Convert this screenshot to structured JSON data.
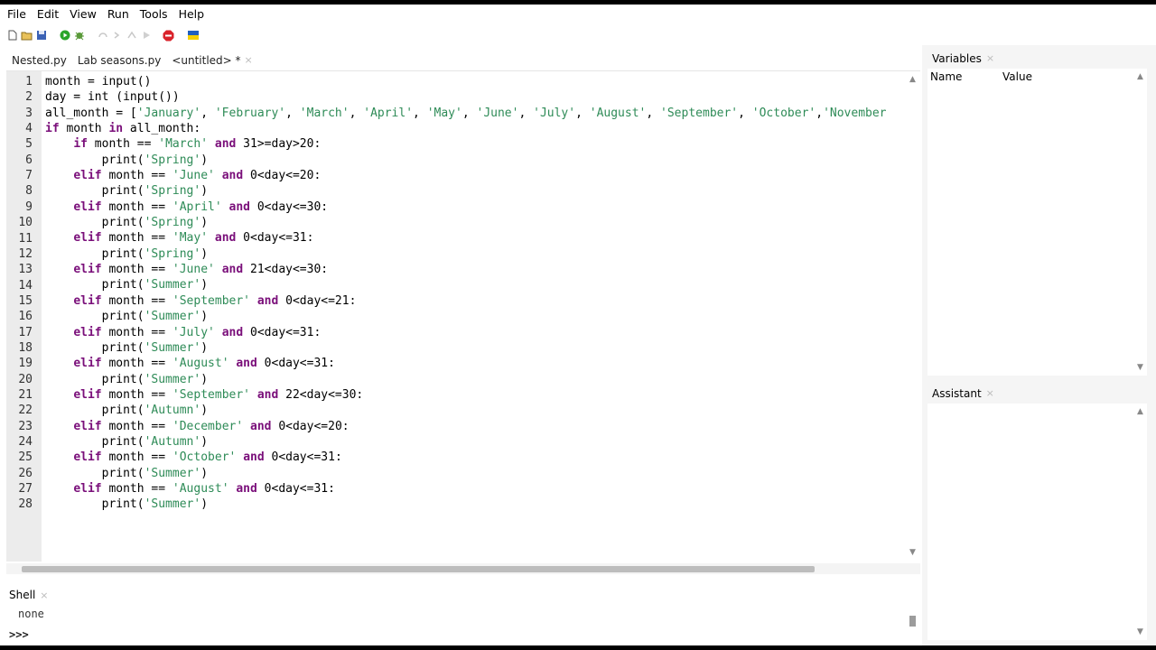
{
  "menu": [
    "File",
    "Edit",
    "View",
    "Run",
    "Tools",
    "Help"
  ],
  "toolbar_icons": [
    "new-file-icon",
    "open-file-icon",
    "save-icon",
    "run-icon",
    "debug-icon",
    "step-over-icon",
    "step-into-icon",
    "step-out-icon",
    "resume-icon",
    "stop-icon",
    "ukraine-flag-icon"
  ],
  "colors": {
    "keyword": "#7a0f7a",
    "string": "#2e8b57",
    "gutter": "#ececec",
    "panel": "#f5f5f5",
    "run": "#2aa52a",
    "stop": "#d9232b"
  },
  "editor_tabs": [
    {
      "label": "Nested.py",
      "active": false
    },
    {
      "label": "Lab seasons.py",
      "active": false
    },
    {
      "label": "<untitled> *",
      "active": true
    }
  ],
  "tab_close": "×",
  "code_lines": [
    [
      [
        "",
        "month = input()"
      ]
    ],
    [
      [
        "",
        "day = int (input())"
      ]
    ],
    [
      [
        "",
        "all_month = ["
      ],
      [
        "s",
        "'January'"
      ],
      [
        "",
        ", "
      ],
      [
        "s",
        "'February'"
      ],
      [
        "",
        ", "
      ],
      [
        "s",
        "'March'"
      ],
      [
        "",
        ", "
      ],
      [
        "s",
        "'April'"
      ],
      [
        "",
        ", "
      ],
      [
        "s",
        "'May'"
      ],
      [
        "",
        ", "
      ],
      [
        "s",
        "'June'"
      ],
      [
        "",
        ", "
      ],
      [
        "s",
        "'July'"
      ],
      [
        "",
        ", "
      ],
      [
        "s",
        "'August'"
      ],
      [
        "",
        ", "
      ],
      [
        "s",
        "'September'"
      ],
      [
        "",
        ", "
      ],
      [
        "s",
        "'October'"
      ],
      [
        "",
        ","
      ],
      [
        "s",
        "'November"
      ]
    ],
    [
      [
        "k",
        "if"
      ],
      [
        "",
        " month "
      ],
      [
        "k",
        "in"
      ],
      [
        "",
        " all_month:"
      ]
    ],
    [
      [
        "",
        "    "
      ],
      [
        "k",
        "if"
      ],
      [
        "",
        " month == "
      ],
      [
        "s",
        "'March'"
      ],
      [
        "",
        " "
      ],
      [
        "k",
        "and"
      ],
      [
        "",
        " 31>=day>20:"
      ]
    ],
    [
      [
        "",
        "        print("
      ],
      [
        "s",
        "'Spring'"
      ],
      [
        "",
        ")"
      ]
    ],
    [
      [
        "",
        "    "
      ],
      [
        "k",
        "elif"
      ],
      [
        "",
        " month == "
      ],
      [
        "s",
        "'June'"
      ],
      [
        "",
        " "
      ],
      [
        "k",
        "and"
      ],
      [
        "",
        " 0<day<=20:"
      ]
    ],
    [
      [
        "",
        "        print("
      ],
      [
        "s",
        "'Spring'"
      ],
      [
        "",
        ")"
      ]
    ],
    [
      [
        "",
        "    "
      ],
      [
        "k",
        "elif"
      ],
      [
        "",
        " month == "
      ],
      [
        "s",
        "'April'"
      ],
      [
        "",
        " "
      ],
      [
        "k",
        "and"
      ],
      [
        "",
        " 0<day<=30:"
      ]
    ],
    [
      [
        "",
        "        print("
      ],
      [
        "s",
        "'Spring'"
      ],
      [
        "",
        ")"
      ]
    ],
    [
      [
        "",
        "    "
      ],
      [
        "k",
        "elif"
      ],
      [
        "",
        " month == "
      ],
      [
        "s",
        "'May'"
      ],
      [
        "",
        " "
      ],
      [
        "k",
        "and"
      ],
      [
        "",
        " 0<day<=31:"
      ]
    ],
    [
      [
        "",
        "        print("
      ],
      [
        "s",
        "'Spring'"
      ],
      [
        "",
        ")"
      ]
    ],
    [
      [
        "",
        "    "
      ],
      [
        "k",
        "elif"
      ],
      [
        "",
        " month == "
      ],
      [
        "s",
        "'June'"
      ],
      [
        "",
        " "
      ],
      [
        "k",
        "and"
      ],
      [
        "",
        " 21<day<=30:"
      ]
    ],
    [
      [
        "",
        "        print("
      ],
      [
        "s",
        "'Summer'"
      ],
      [
        "",
        ")"
      ]
    ],
    [
      [
        "",
        "    "
      ],
      [
        "k",
        "elif"
      ],
      [
        "",
        " month == "
      ],
      [
        "s",
        "'September'"
      ],
      [
        "",
        " "
      ],
      [
        "k",
        "and"
      ],
      [
        "",
        " 0<day<=21:"
      ]
    ],
    [
      [
        "",
        "        print("
      ],
      [
        "s",
        "'Summer'"
      ],
      [
        "",
        ")"
      ]
    ],
    [
      [
        "",
        "    "
      ],
      [
        "k",
        "elif"
      ],
      [
        "",
        " month == "
      ],
      [
        "s",
        "'July'"
      ],
      [
        "",
        " "
      ],
      [
        "k",
        "and"
      ],
      [
        "",
        " 0<day<=31:"
      ]
    ],
    [
      [
        "",
        "        print("
      ],
      [
        "s",
        "'Summer'"
      ],
      [
        "",
        ")"
      ]
    ],
    [
      [
        "",
        "    "
      ],
      [
        "k",
        "elif"
      ],
      [
        "",
        " month == "
      ],
      [
        "s",
        "'August'"
      ],
      [
        "",
        " "
      ],
      [
        "k",
        "and"
      ],
      [
        "",
        " 0<day<=31:"
      ]
    ],
    [
      [
        "",
        "        print("
      ],
      [
        "s",
        "'Summer'"
      ],
      [
        "",
        ")"
      ]
    ],
    [
      [
        "",
        "    "
      ],
      [
        "k",
        "elif"
      ],
      [
        "",
        " month == "
      ],
      [
        "s",
        "'September'"
      ],
      [
        "",
        " "
      ],
      [
        "k",
        "and"
      ],
      [
        "",
        " 22<day<=30:"
      ]
    ],
    [
      [
        "",
        "        print("
      ],
      [
        "s",
        "'Autumn'"
      ],
      [
        "",
        ")"
      ]
    ],
    [
      [
        "",
        "    "
      ],
      [
        "k",
        "elif"
      ],
      [
        "",
        " month == "
      ],
      [
        "s",
        "'December'"
      ],
      [
        "",
        " "
      ],
      [
        "k",
        "and"
      ],
      [
        "",
        " 0<day<=20:"
      ]
    ],
    [
      [
        "",
        "        print("
      ],
      [
        "s",
        "'Autumn'"
      ],
      [
        "",
        ")"
      ]
    ],
    [
      [
        "",
        "    "
      ],
      [
        "k",
        "elif"
      ],
      [
        "",
        " month == "
      ],
      [
        "s",
        "'October'"
      ],
      [
        "",
        " "
      ],
      [
        "k",
        "and"
      ],
      [
        "",
        " 0<day<=31:"
      ]
    ],
    [
      [
        "",
        "        print("
      ],
      [
        "s",
        "'Summer'"
      ],
      [
        "",
        ")"
      ]
    ],
    [
      [
        "",
        "    "
      ],
      [
        "k",
        "elif"
      ],
      [
        "",
        " month == "
      ],
      [
        "s",
        "'August'"
      ],
      [
        "",
        " "
      ],
      [
        "k",
        "and"
      ],
      [
        "",
        " 0<day<=31:"
      ]
    ],
    [
      [
        "",
        "        print("
      ],
      [
        "s",
        "'Summer'"
      ],
      [
        "",
        ")"
      ]
    ]
  ],
  "shell": {
    "tab": "Shell",
    "output": "none",
    "prompt": ">>>"
  },
  "variables": {
    "tab": "Variables",
    "col_name": "Name",
    "col_value": "Value"
  },
  "assistant": {
    "tab": "Assistant"
  }
}
